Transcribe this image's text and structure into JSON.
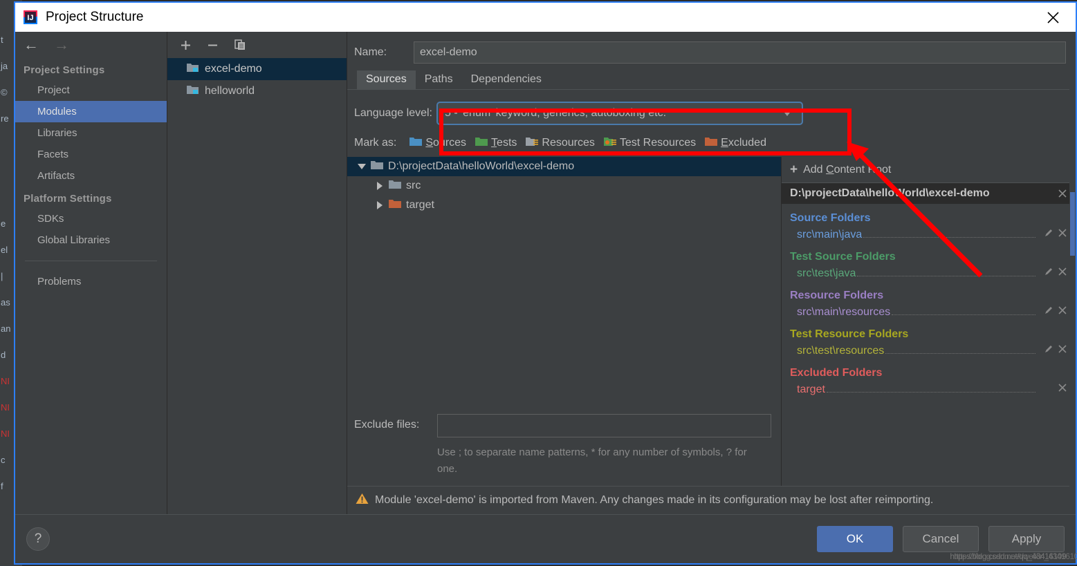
{
  "window": {
    "title": "Project Structure",
    "app_icon": "intellij-idea-icon",
    "close_icon": "close-icon"
  },
  "nav": {
    "back_icon": "back-arrow-icon",
    "forward_icon": "forward-arrow-icon",
    "groups": [
      {
        "label": "Project Settings",
        "items": [
          {
            "label": "Project",
            "selected": false
          },
          {
            "label": "Modules",
            "selected": true
          },
          {
            "label": "Libraries",
            "selected": false
          },
          {
            "label": "Facets",
            "selected": false
          },
          {
            "label": "Artifacts",
            "selected": false
          }
        ]
      },
      {
        "label": "Platform Settings",
        "items": [
          {
            "label": "SDKs",
            "selected": false
          },
          {
            "label": "Global Libraries",
            "selected": false
          }
        ]
      }
    ],
    "problems_label": "Problems"
  },
  "modules_panel": {
    "toolbar": {
      "add_icon": "plus-icon",
      "remove_icon": "minus-icon",
      "copy_icon": "copy-icon"
    },
    "items": [
      {
        "label": "excel-demo",
        "selected": true
      },
      {
        "label": "helloworld",
        "selected": false
      }
    ]
  },
  "main": {
    "name_label": "Name:",
    "name_value": "excel-demo",
    "name_placeholder": "",
    "tabs": [
      {
        "label": "Sources",
        "active": true
      },
      {
        "label": "Paths",
        "active": false
      },
      {
        "label": "Dependencies",
        "active": false
      }
    ],
    "language_level": {
      "label": "Language level:",
      "value": "5 - 'enum' keyword, generics, autoboxing etc.",
      "arrow_icon": "chevron-down-icon"
    },
    "mark_as": {
      "label": "Mark as:",
      "buttons": [
        {
          "label": "Sources",
          "mnemonic": "S",
          "icon": "folder-sources-icon",
          "color": "#4a90c4"
        },
        {
          "label": "Tests",
          "mnemonic": "T",
          "icon": "folder-tests-icon",
          "color": "#4e9a4e"
        },
        {
          "label": "Resources",
          "mnemonic": "",
          "icon": "folder-resources-icon",
          "color": "#9aa0a6"
        },
        {
          "label": "Test Resources",
          "mnemonic": "",
          "icon": "folder-test-resources-icon",
          "color": "#4e9a4e"
        },
        {
          "label": "Excluded",
          "mnemonic": "E",
          "icon": "folder-excluded-icon",
          "color": "#c2613a"
        }
      ]
    },
    "tree": [
      {
        "label": "D:\\projectData\\helloWorld\\excel-demo",
        "depth": 0,
        "expanded": true,
        "selected": true,
        "folder_color": "#8a96a0"
      },
      {
        "label": "src",
        "depth": 1,
        "expanded": false,
        "selected": false,
        "folder_color": "#8a96a0"
      },
      {
        "label": "target",
        "depth": 1,
        "expanded": false,
        "selected": false,
        "folder_color": "#c2613a"
      }
    ],
    "exclude_files": {
      "label": "Exclude files:",
      "value": "",
      "placeholder": "",
      "hint": "Use ; to separate name patterns, * for any number of symbols, ? for one."
    },
    "warning": {
      "icon": "warning-triangle-icon",
      "text": "Module 'excel-demo' is imported from Maven. Any changes made in its configuration may be lost after reimporting."
    }
  },
  "content_roots": {
    "add_label": "Add Content Root",
    "add_icon": "plus-icon",
    "root_path": "D:\\projectData\\helloWorld\\excel-demo",
    "root_remove_icon": "close-icon",
    "groups": [
      {
        "title": "Source Folders",
        "color": "#5b8fd6",
        "entries": [
          {
            "path": "src\\main\\java",
            "color": "#6b9fe0",
            "edit_icon": "pencil-icon",
            "remove_icon": "close-icon",
            "has_edit": true
          }
        ]
      },
      {
        "title": "Test Source Folders",
        "color": "#4c9c68",
        "entries": [
          {
            "path": "src\\test\\java",
            "color": "#5aa87a",
            "edit_icon": "pencil-icon",
            "remove_icon": "close-icon",
            "has_edit": true
          }
        ]
      },
      {
        "title": "Resource Folders",
        "color": "#9b7fc4",
        "entries": [
          {
            "path": "src\\main\\resources",
            "color": "#a98fd0",
            "edit_icon": "pencil-icon",
            "remove_icon": "close-icon",
            "has_edit": true
          }
        ]
      },
      {
        "title": "Test Resource Folders",
        "color": "#a8a820",
        "entries": [
          {
            "path": "src\\test\\resources",
            "color": "#b3b33a",
            "edit_icon": "pencil-icon",
            "remove_icon": "close-icon",
            "has_edit": true
          }
        ]
      },
      {
        "title": "Excluded Folders",
        "color": "#e05c5c",
        "entries": [
          {
            "path": "target",
            "color": "#e86f6f",
            "edit_icon": "",
            "remove_icon": "close-icon",
            "has_edit": false
          }
        ]
      }
    ]
  },
  "footer": {
    "help_label": "?",
    "help_icon": "question-mark-icon",
    "ok_label": "OK",
    "cancel_label": "Cancel",
    "apply_label": "Apply"
  },
  "watermark": {
    "line_a": "https://blog.csdn.net/qq_43416109",
    "line_b": "https://blog.csdn.net/weixin_43416109"
  },
  "annotation": {
    "highlight_color": "#ff0000",
    "description": "red rectangle around language level combo with arrow pointing to it"
  },
  "background_strip": {
    "lines": [
      "t",
      "ja",
      "©",
      "re",
      "",
      "",
      "",
      "e",
      "el",
      "|",
      "as",
      "an",
      "d",
      "NI",
      "NI",
      "NI",
      "c",
      "f"
    ]
  }
}
